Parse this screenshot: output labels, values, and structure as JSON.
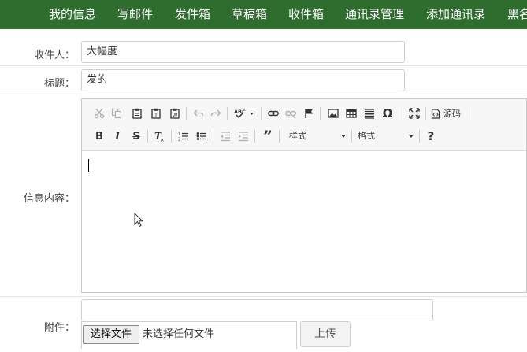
{
  "nav": {
    "items": [
      {
        "label": "我的信息",
        "icon": ""
      },
      {
        "label": "写邮件"
      },
      {
        "label": "发件箱"
      },
      {
        "label": "草稿箱"
      },
      {
        "label": "收件箱"
      },
      {
        "label": "通讯录管理"
      },
      {
        "label": "添加通讯录"
      },
      {
        "label": "黑名"
      }
    ]
  },
  "form": {
    "recipient_label": "收件人：",
    "recipient_value": "大幅度",
    "subject_label": "标题：",
    "subject_value": "发的",
    "content_label": "信息内容：",
    "attachment_label": "附件：",
    "attachment_path_value": "",
    "file_button_label": "选择文件",
    "file_status": "未选择任何文件",
    "upload_button_label": "上传"
  },
  "editor": {
    "source_label": "源码",
    "styles_combo": "样式",
    "format_combo": "格式",
    "help_label": "?",
    "content": ""
  },
  "colors": {
    "nav_background": "#2f6d2f",
    "nav_text": "#ffffff"
  }
}
